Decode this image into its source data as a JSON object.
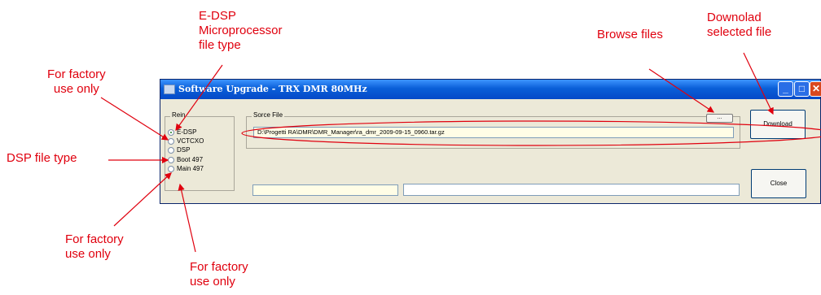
{
  "window": {
    "title": "Software Upgrade - TRX DMR 80MHz",
    "minimize_glyph": "_",
    "maximize_glyph": "□",
    "close_glyph": "✕"
  },
  "radio_group": {
    "label": "Rein",
    "options": [
      {
        "label": "E-DSP",
        "selected": true
      },
      {
        "label": "VCTCXO",
        "selected": false
      },
      {
        "label": "DSP",
        "selected": false
      },
      {
        "label": "Boot 497",
        "selected": false
      },
      {
        "label": "Main 497",
        "selected": false
      }
    ]
  },
  "source_file": {
    "label": "Sorce File",
    "path": "D:\\Progetti RA\\DMR\\DMR_Manager\\ra_dmr_2009-09-15_0960.tar.gz",
    "browse_label": "..."
  },
  "buttons": {
    "download": "Download",
    "close": "Close"
  },
  "annotations": {
    "edsp_type": [
      "E-DSP",
      "Microprocessor",
      "file type"
    ],
    "factory_top": [
      "For factory",
      "use only"
    ],
    "dsp_type": "DSP file type",
    "factory_bottom_left": [
      "For factory",
      "use only"
    ],
    "factory_bottom_right": [
      "For factory",
      "use only"
    ],
    "browse_files": "Browse files",
    "download_selected": [
      "Downolad",
      "selected file"
    ]
  },
  "colors": {
    "annotation": "#e0000e",
    "titlebar": "#0a5fd8",
    "dialog_bg": "#ece9d8"
  }
}
